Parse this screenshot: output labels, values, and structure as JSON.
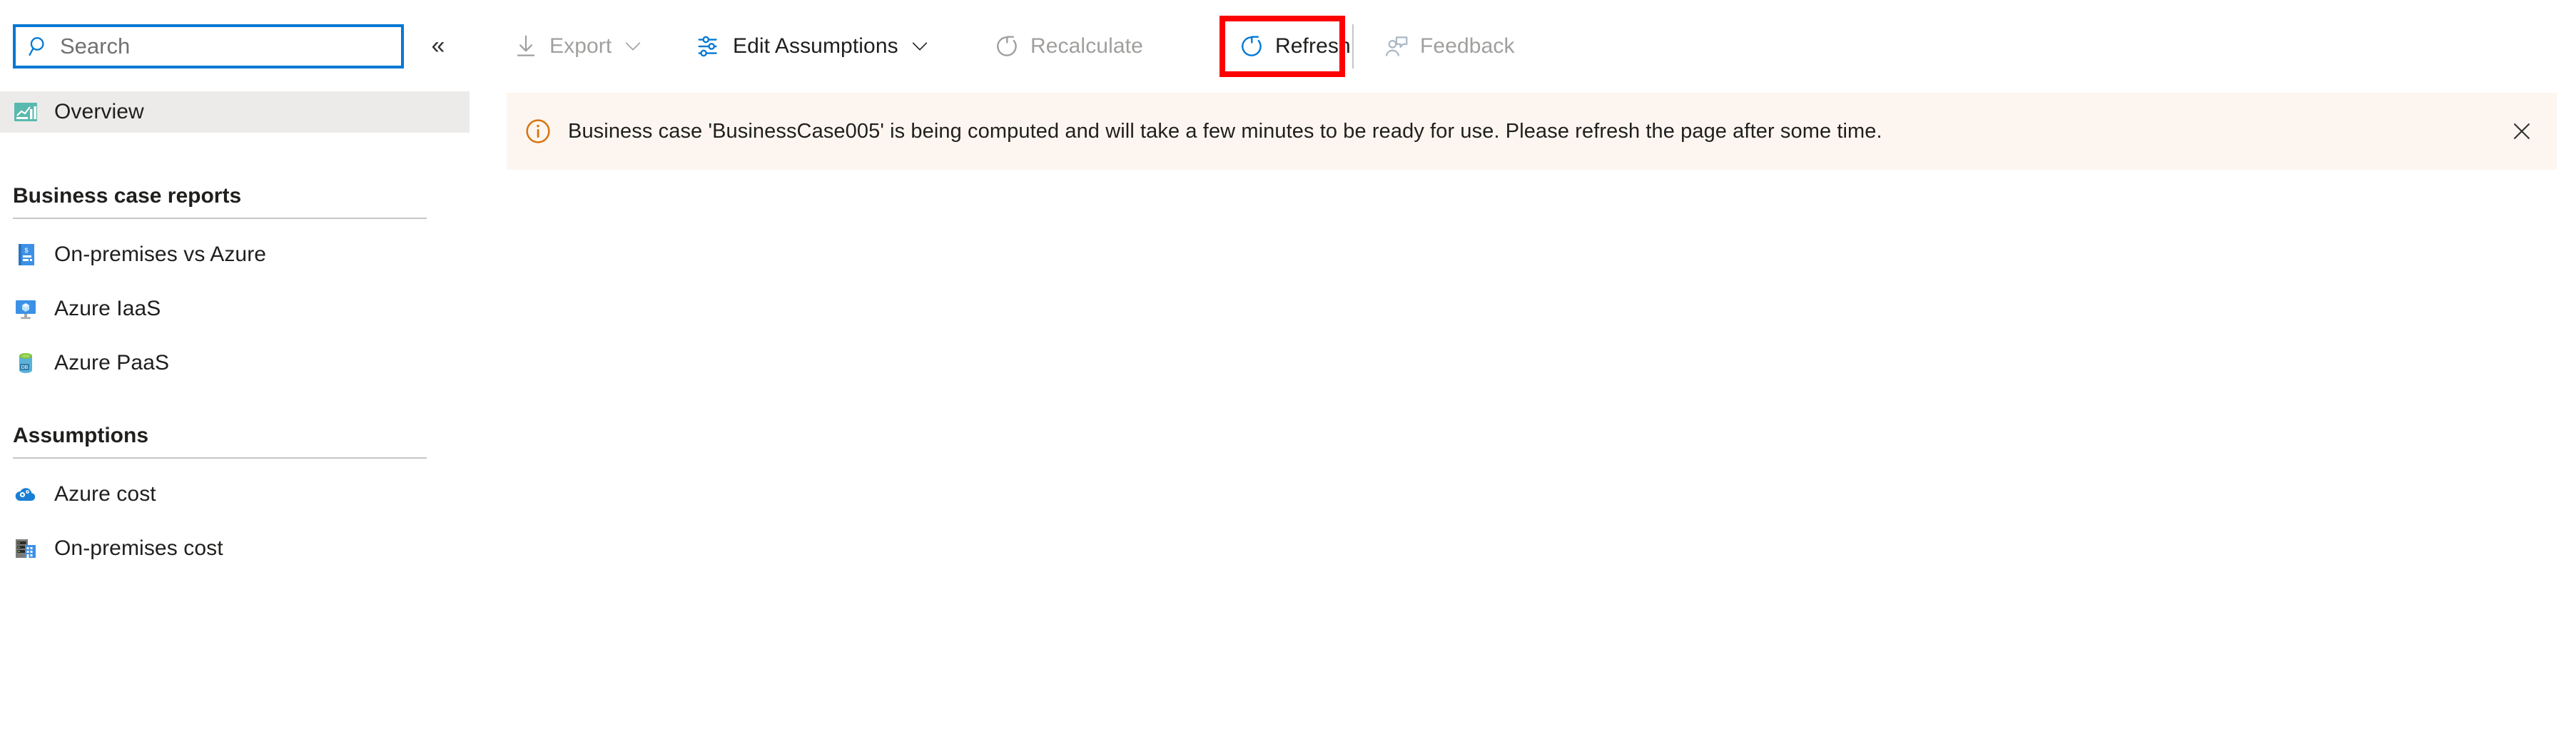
{
  "sidebar": {
    "search": {
      "placeholder": "Search",
      "value": "",
      "icon": "search-icon"
    },
    "collapse": {
      "label": "«",
      "icon": "chevron-double-left-icon"
    },
    "overview": {
      "label": "Overview",
      "icon": "chart-report-icon",
      "selected": true
    },
    "sections": [
      {
        "title": "Business case reports",
        "items": [
          {
            "label": "On-premises vs Azure",
            "icon": "invoice-dollar-icon"
          },
          {
            "label": "Azure IaaS",
            "icon": "azure-vm-monitor-icon"
          },
          {
            "label": "Azure PaaS",
            "icon": "azure-database-icon"
          }
        ]
      },
      {
        "title": "Assumptions",
        "items": [
          {
            "label": "Azure cost",
            "icon": "azure-cloud-gear-icon"
          },
          {
            "label": "On-premises cost",
            "icon": "server-building-icon"
          }
        ]
      }
    ]
  },
  "toolbar": {
    "buttons": [
      {
        "label": "Export",
        "icon": "download-arrow-icon",
        "disabled": true,
        "has_caret": true
      },
      {
        "label": "Edit Assumptions",
        "icon": "sliders-icon",
        "disabled": false,
        "has_caret": true
      },
      {
        "label": "Recalculate",
        "icon": "refresh-circle-icon",
        "disabled": true,
        "has_caret": false
      },
      {
        "label": "Refresh",
        "icon": "refresh-circle-icon",
        "disabled": false,
        "has_caret": false
      },
      {
        "label": "Feedback",
        "icon": "person-feedback-icon",
        "disabled": true,
        "has_caret": false
      }
    ],
    "highlighted_button": "Refresh"
  },
  "banner": {
    "icon": "info-circle-icon",
    "message": "Business case 'BusinessCase005' is being computed and will take a few minutes to be ready for use. Please refresh the page after some time.",
    "close_icon": "close-icon",
    "background": "#fdf6f0",
    "accent": "#d9730d"
  },
  "colors": {
    "accent_blue": "#0078d4",
    "highlight_red": "#ff0000",
    "selected_bg": "#edebe9",
    "text_primary": "#201f1e",
    "text_disabled": "#a19f9d"
  }
}
